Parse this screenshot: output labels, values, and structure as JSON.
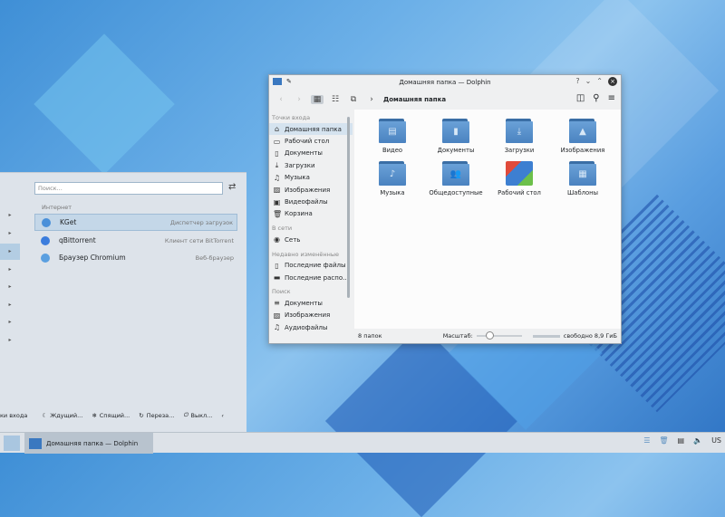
{
  "launcher": {
    "search_placeholder": "Поиск...",
    "section": "Интернет",
    "apps": [
      {
        "name": "KGet",
        "desc": "Диспетчер загрузок",
        "color": "#4a90d9"
      },
      {
        "name": "qBittorrent",
        "desc": "Клиент сети BitTorrent",
        "color": "#3b7ddd"
      },
      {
        "name": "Браузер Chromium",
        "desc": "Веб-браузер",
        "color": "#5a9fe0"
      }
    ],
    "footer": {
      "left": "ки входа",
      "sleep": "Ждущий...",
      "hibernate": "Спящий...",
      "restart": "Переза...",
      "shutdown": "Выкл..."
    }
  },
  "taskbar": {
    "task": "Домашняя папка — Dolphin",
    "layout": "US"
  },
  "dolphin": {
    "title": "Домашняя папка — Dolphin",
    "breadcrumb": "Домашняя папка",
    "sidebar": [
      {
        "header": "Точки входа",
        "items": [
          {
            "label": "Домашняя папка",
            "icon": "⌂",
            "selected": true
          },
          {
            "label": "Рабочий стол",
            "icon": "▭"
          },
          {
            "label": "Документы",
            "icon": "▯"
          },
          {
            "label": "Загрузки",
            "icon": "⤓"
          },
          {
            "label": "Музыка",
            "icon": "♫"
          },
          {
            "label": "Изображения",
            "icon": "▨"
          },
          {
            "label": "Видеофайлы",
            "icon": "▣"
          },
          {
            "label": "Корзина",
            "icon": "🗑"
          }
        ]
      },
      {
        "header": "В сети",
        "items": [
          {
            "label": "Сеть",
            "icon": "◉"
          }
        ]
      },
      {
        "header": "Недавно изменённые",
        "items": [
          {
            "label": "Последние файлы",
            "icon": "▯"
          },
          {
            "label": "Последние распо...",
            "icon": "▬"
          }
        ]
      },
      {
        "header": "Поиск",
        "items": [
          {
            "label": "Документы",
            "icon": "≡"
          },
          {
            "label": "Изображения",
            "icon": "▨"
          },
          {
            "label": "Аудиофайлы",
            "icon": "♫"
          }
        ]
      }
    ],
    "folders": [
      {
        "name": "Видео",
        "glyph": "▤"
      },
      {
        "name": "Документы",
        "glyph": "▮"
      },
      {
        "name": "Загрузки",
        "glyph": "⤓"
      },
      {
        "name": "Изображения",
        "glyph": "▲"
      },
      {
        "name": "Музыка",
        "glyph": "♪"
      },
      {
        "name": "Общедоступные",
        "glyph": "👥"
      },
      {
        "name": "Рабочий стол",
        "glyph": "desktop"
      },
      {
        "name": "Шаблоны",
        "glyph": "▦"
      }
    ],
    "status": {
      "count": "8 папок",
      "zoom_label": "Масштаб:",
      "free": "свободно 8,9 ГиБ"
    }
  }
}
